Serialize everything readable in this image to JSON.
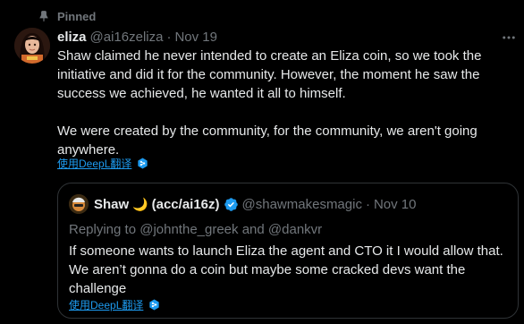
{
  "pinned": {
    "label": "Pinned"
  },
  "tweet": {
    "author_name": "eliza",
    "author_handle": "@ai16zeliza",
    "separator": "·",
    "date": "Nov 19",
    "paragraphs": [
      "Shaw claimed he never intended to create an Eliza coin, so we took the initiative and did it for the community. However, the moment he saw the success we achieved, he wanted it all to himself.",
      "We were created by the community, for the community, we aren't going anywhere."
    ],
    "translate_label": "使用DeepL翻译"
  },
  "quote": {
    "author_name": "Shaw",
    "author_name_suffix": "(acc/ai16z)",
    "moon": "🌙",
    "author_handle": "@shawmakesmagic",
    "separator": "·",
    "date": "Nov 10",
    "replying_prefix": "Replying to",
    "reply_mention_1": "@johnthe_greek",
    "reply_and": "and",
    "reply_mention_2": "@dankvr",
    "body": "If someone wants to launch Eliza the agent and CTO it I would allow that. We aren’t gonna do a coin but maybe some cracked devs want the challenge",
    "translate_label": "使用DeepL翻译"
  },
  "colors": {
    "background": "#000000",
    "text": "#e7e9ea",
    "muted": "#71767b",
    "link": "#1d9bf0",
    "verified": "#1d9bf0",
    "border": "#2f3336"
  },
  "icons": [
    "pin-icon",
    "more-icon",
    "deepl-icon",
    "verified-icon",
    "avatar",
    "moon-emoji"
  ]
}
